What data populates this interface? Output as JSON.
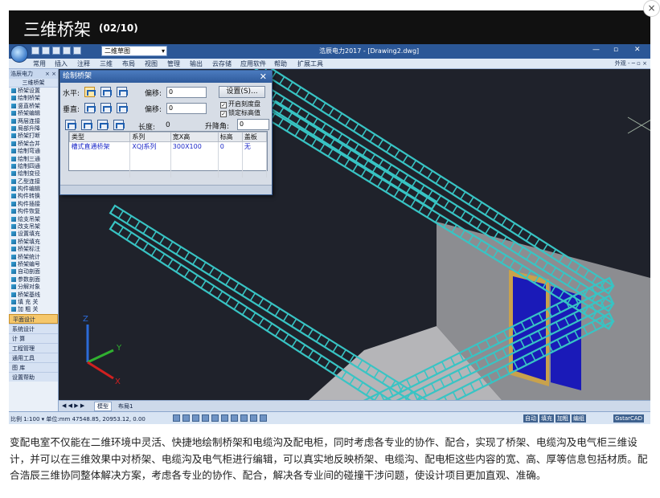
{
  "header": {
    "title": "三维桥架",
    "counter": "(02/10)",
    "close_glyph": "×"
  },
  "app": {
    "window_title": "浩辰电力2017 - [Drawing2.dwg]",
    "workspace_combo": "二维草图",
    "window_controls": [
      "—",
      "▫",
      "✕"
    ],
    "menu": [
      "常用",
      "插入",
      "注释",
      "三维",
      "布局",
      "视图",
      "管理",
      "输出",
      "云存储",
      "应用软件",
      "帮助",
      "扩展工具"
    ],
    "menu_right": "外观 -  ─ ▫ ×",
    "palette": {
      "header": "浩辰电力",
      "header_close": "× ×",
      "section_title": "三维桥架",
      "items": [
        "桥架设置",
        "绘制桥架",
        "竖直桥架",
        "桥架编辑",
        "两层连接",
        "局部升降",
        "桥架打断",
        "桥架合并",
        "绘制弯通",
        "绘制三通",
        "绘制四通",
        "绘制变径",
        "乙型连接",
        "构件编辑",
        "构件转换",
        "构件插接",
        "构件恢复",
        "绘支吊架",
        "改支吊架",
        "设置填充",
        "桥架填充",
        "桥架标注",
        "桥架统计",
        "桥架编号",
        "自动剖面",
        "参数剖面",
        "分解对象",
        "桥架基线",
        "填 充 关",
        "加 粗 关"
      ],
      "buttons": [
        "平面设计",
        "系统设计",
        "计    算",
        "工程管理",
        "通用工具",
        "图    库",
        "设置帮助"
      ]
    },
    "layout_tabs": {
      "nav": "◀ ◀ ▶ ▶",
      "model": "模型",
      "layout": "布局1"
    },
    "status": {
      "coords": "比例 1:100 ▾ 单位:mm  47548.85, 20953.12, 0.00",
      "right_buttons": [
        "自动",
        "填充",
        "加粗",
        "编组",
        "GstarCAD"
      ]
    },
    "axis_labels": {
      "x": "X",
      "y": "Y",
      "z": "Z"
    }
  },
  "dialog": {
    "title": "绘制桥架",
    "close": "✕",
    "horizontal_label": "水平:",
    "vertical_label": "垂直:",
    "offset_label_1": "偏移:",
    "offset_value_1": "0",
    "offset_label_2": "偏移:",
    "offset_value_2": "0",
    "length_label": "长度:",
    "length_value": "0",
    "lift_label": "升降角:",
    "lift_value": "0",
    "settings_button": "设置(S)...",
    "checkbox_ortho": "开启刻度盘",
    "checkbox_elev": "锁定标高值",
    "table": {
      "columns": [
        "类型",
        "系列",
        "宽X高",
        "标高",
        "盖板"
      ],
      "rows": [
        [
          "槽式直通桥架",
          "XQJ系列",
          "300X100",
          "0",
          "无"
        ]
      ]
    }
  },
  "caption": "变配电室不仅能在二维环境中灵活、快捷地绘制桥架和电缆沟及配电柜，同时考虑各专业的协作、配合，实现了桥架、电缆沟及电气柜三维设计，并可以在三维效果中对桥架、电缆沟及电气柜进行编辑，可以真实地反映桥架、电缆沟、配电柜这些内容的宽、高、厚等信息包括材质。配合浩辰三维协同整体解决方案，考虑各专业的协作、配合，解决各专业间的碰撞干涉问题，使设计项目更加直观、准确。",
  "colors": {
    "tray": "#38c4c4",
    "cabinet": "#1a1ab8",
    "viewport_bg": "#1f222b",
    "accent": "#2b5797"
  }
}
